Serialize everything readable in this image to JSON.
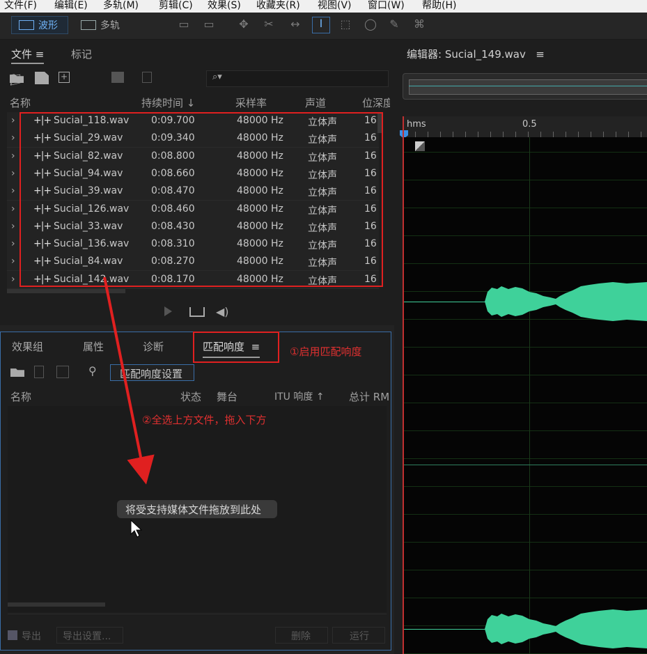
{
  "menu": [
    "文件(F)",
    "编辑(E)",
    "多轨(M)",
    "剪辑(C)",
    "效果(S)",
    "收藏夹(R)",
    "视图(V)",
    "窗口(W)",
    "帮助(H)"
  ],
  "toolbar": {
    "waveform": "波形",
    "multitrack": "多轨"
  },
  "files_panel": {
    "tab_files": "文件",
    "tab_markers": "标记",
    "columns": [
      "名称",
      "持续时间 ↓",
      "采样率",
      "声道",
      "位深度"
    ],
    "rows": [
      {
        "name": "Sucial_118.wav",
        "duration": "0:09.700",
        "rate": "48000 Hz",
        "channels": "立体声",
        "depth": "16"
      },
      {
        "name": "Sucial_29.wav",
        "duration": "0:09.340",
        "rate": "48000 Hz",
        "channels": "立体声",
        "depth": "16"
      },
      {
        "name": "Sucial_82.wav",
        "duration": "0:08.800",
        "rate": "48000 Hz",
        "channels": "立体声",
        "depth": "16"
      },
      {
        "name": "Sucial_94.wav",
        "duration": "0:08.660",
        "rate": "48000 Hz",
        "channels": "立体声",
        "depth": "16"
      },
      {
        "name": "Sucial_39.wav",
        "duration": "0:08.470",
        "rate": "48000 Hz",
        "channels": "立体声",
        "depth": "16"
      },
      {
        "name": "Sucial_126.wav",
        "duration": "0:08.460",
        "rate": "48000 Hz",
        "channels": "立体声",
        "depth": "16"
      },
      {
        "name": "Sucial_33.wav",
        "duration": "0:08.430",
        "rate": "48000 Hz",
        "channels": "立体声",
        "depth": "16"
      },
      {
        "name": "Sucial_136.wav",
        "duration": "0:08.310",
        "rate": "48000 Hz",
        "channels": "立体声",
        "depth": "16"
      },
      {
        "name": "Sucial_84.wav",
        "duration": "0:08.270",
        "rate": "48000 Hz",
        "channels": "立体声",
        "depth": "16"
      },
      {
        "name": "Sucial_142.wav",
        "duration": "0:08.170",
        "rate": "48000 Hz",
        "channels": "立体声",
        "depth": "16"
      }
    ]
  },
  "lower_panel": {
    "tabs": [
      "效果组",
      "属性",
      "诊断",
      "匹配响度"
    ],
    "settings_button": "匹配响度设置",
    "columns": [
      "名称",
      "状态",
      "舞台",
      "ITU 响度 ↑",
      "总计 RMS"
    ],
    "drop_hint": "将受支持媒体文件拖放到此处",
    "export_label": "导出",
    "export_settings": "导出设置...",
    "clear": "删除",
    "run": "运行"
  },
  "annotations": {
    "note1": "①启用匹配响度",
    "note2": "②全选上方文件，拖入下方"
  },
  "editor": {
    "title": "编辑器: Sucial_149.wav",
    "ruler_unit": "hms",
    "ruler_tick": "0.5"
  },
  "colors": {
    "accent": "#3a8ee6",
    "waveform": "#3fd19a",
    "annotation": "#e02020"
  }
}
